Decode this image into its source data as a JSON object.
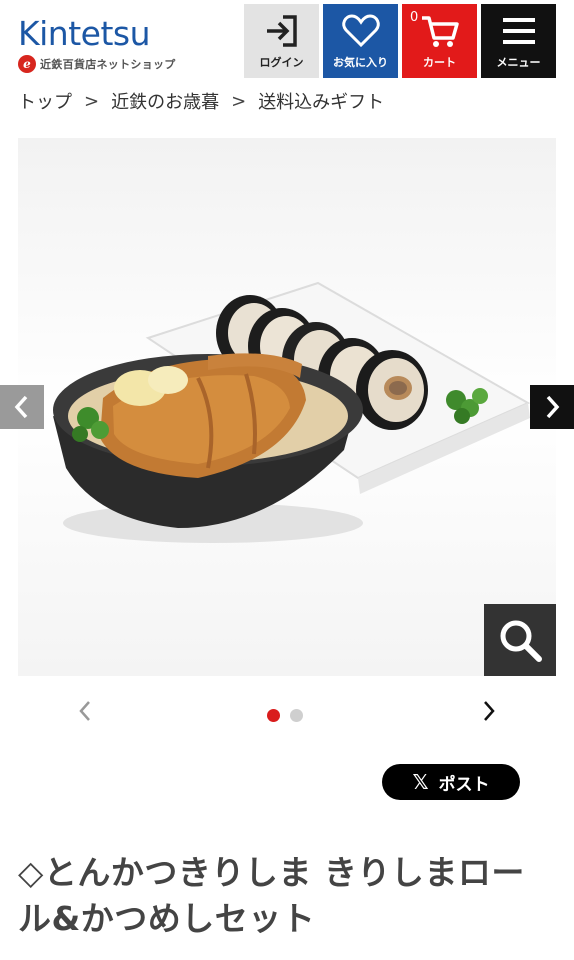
{
  "header": {
    "logo_text": "Kintetsu",
    "logo_sub": "近鉄百貨店ネットショップ",
    "logo_mark": "e",
    "login_label": "ログイン",
    "favorites_label": "お気に入り",
    "cart_label": "カート",
    "cart_count": "0",
    "menu_label": "メニュー",
    "colors": {
      "brand": "#1c57a5",
      "cart": "#e21a1a",
      "menu": "#111111",
      "login": "#e3e3e3"
    }
  },
  "breadcrumb": {
    "items": [
      "トップ",
      "近鉄のお歳暮",
      "送料込みギフト"
    ],
    "separator": ">"
  },
  "gallery": {
    "image_icon": "product-photo",
    "total_images": 2,
    "active_index": 1,
    "prev_icon": "chevron-left-icon",
    "next_icon": "chevron-right-icon",
    "zoom_icon": "magnifier-icon"
  },
  "share": {
    "post_label": "ポスト",
    "x_glyph": "𝕏"
  },
  "product": {
    "title": "◇とんかつきりしま きりしまロール&かつめしセット"
  }
}
